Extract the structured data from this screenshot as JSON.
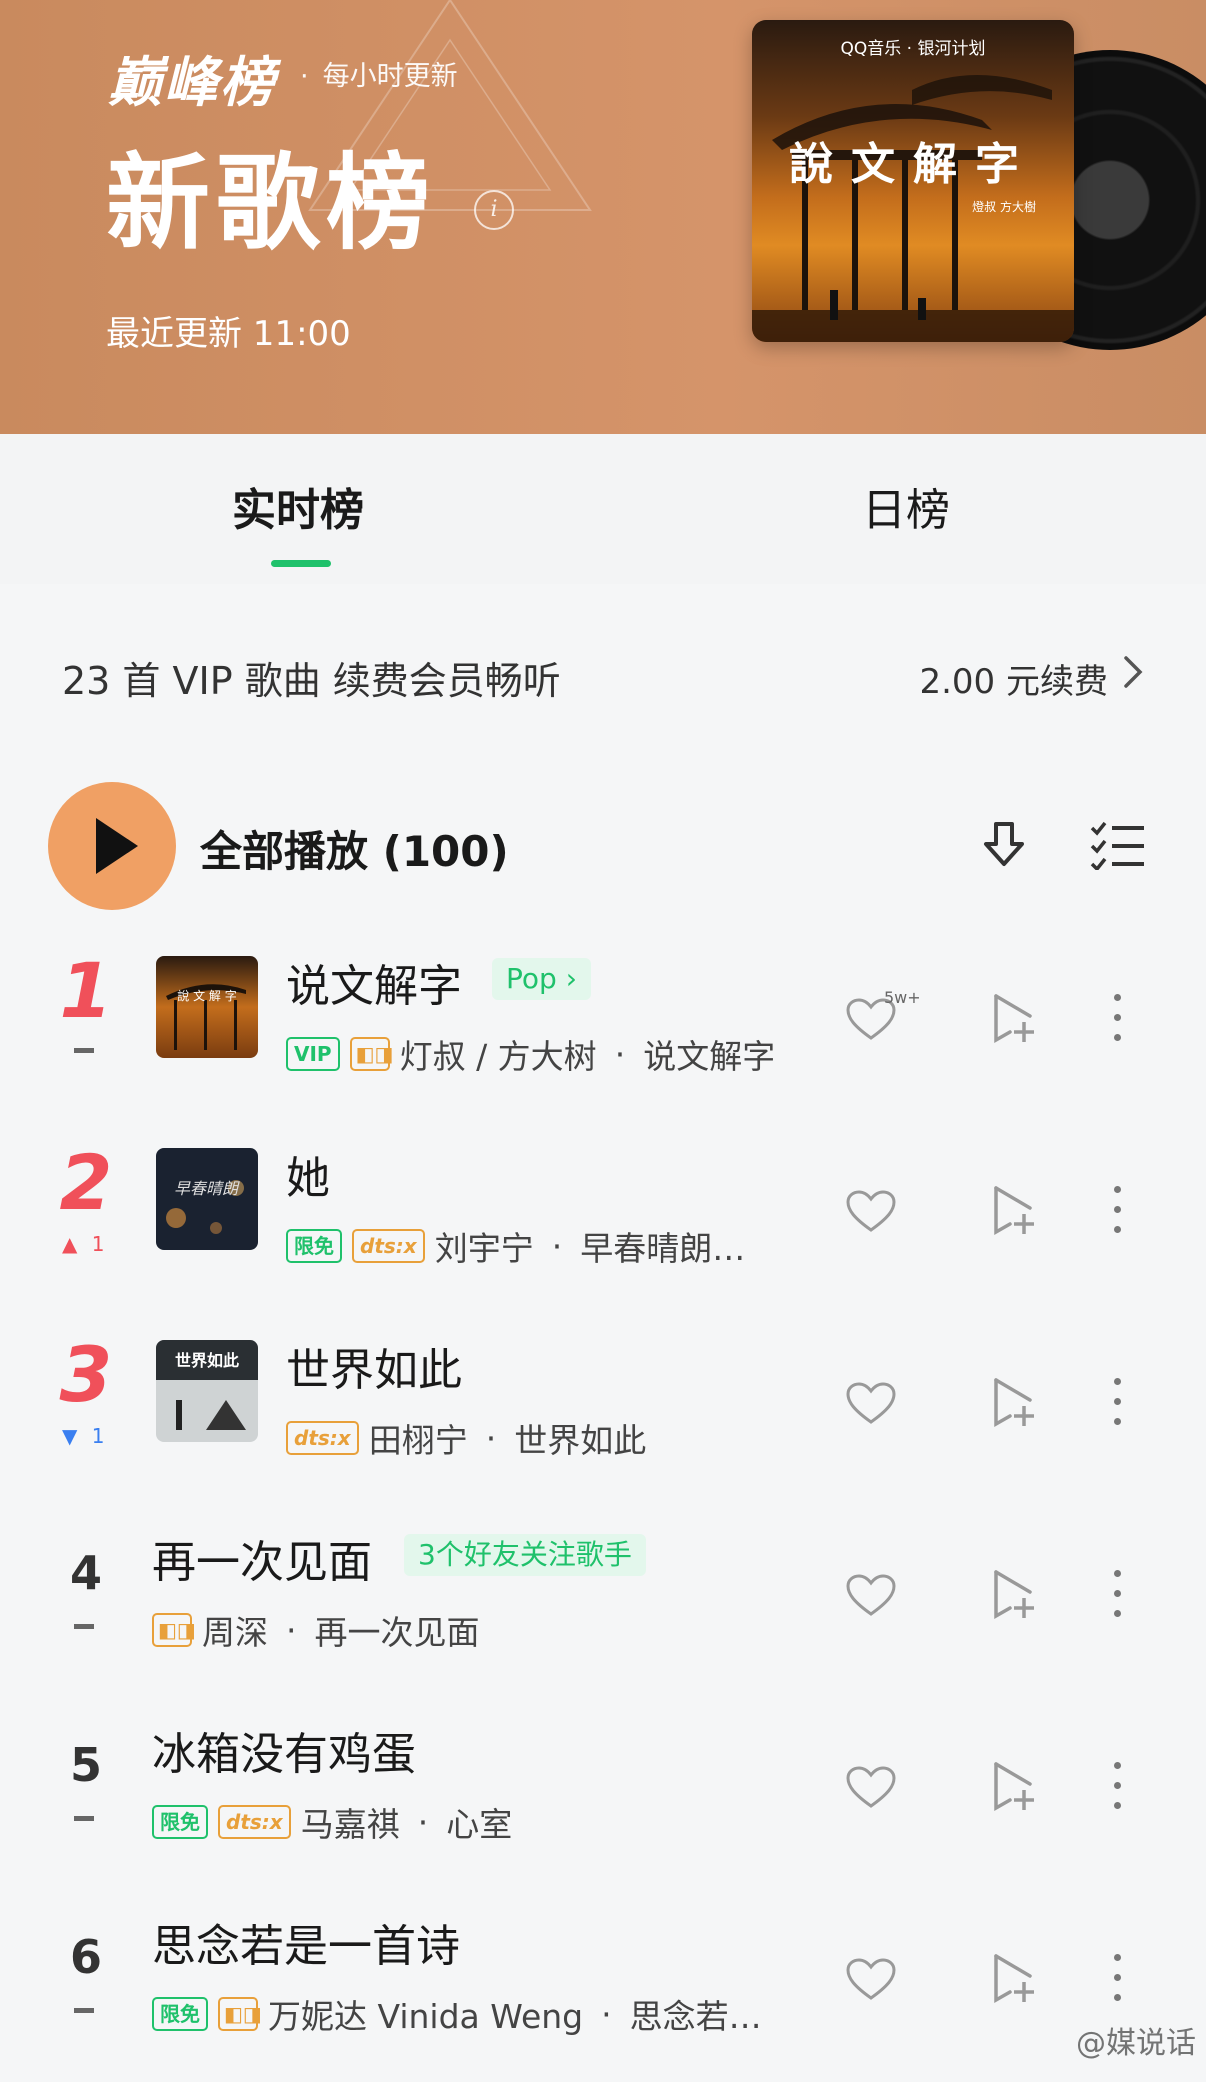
{
  "header": {
    "brand": "巅峰榜",
    "subtitle": "每小时更新",
    "title": "新歌榜",
    "update_label": "最近更新 11:00",
    "cover": {
      "top_label": "QQ音乐 · 银河计划",
      "title": "說文解字",
      "artists": "燈叔 方大樹"
    },
    "bg_color": "#cf9066"
  },
  "tabs": [
    {
      "label": "实时榜",
      "active": true
    },
    {
      "label": "日榜",
      "active": false
    }
  ],
  "vip_banner": {
    "text": "23 首 VIP 歌曲  续费会员畅听",
    "action": "2.00 元续费",
    "chevron": "chevron-right-icon"
  },
  "play_all": {
    "label": "全部播放 (100)",
    "accent": "#f0a064"
  },
  "songs": [
    {
      "rank": "1",
      "trend": "flat",
      "trend_value": "",
      "title": "说文解字",
      "tag": "Pop",
      "chips": [
        "VIP",
        "dolby"
      ],
      "artist": "灯叔 / 方大树",
      "album": "说文解字",
      "likes": "5w+"
    },
    {
      "rank": "2",
      "trend": "up",
      "trend_value": "1",
      "title": "她",
      "tag": "",
      "chips": [
        "限免",
        "dts:x"
      ],
      "artist": "刘宇宁",
      "album": "早春晴朗…",
      "likes": ""
    },
    {
      "rank": "3",
      "trend": "down",
      "trend_value": "1",
      "title": "世界如此",
      "tag": "",
      "chips": [
        "dts:x"
      ],
      "artist": "田栩宁",
      "album": "世界如此",
      "likes": ""
    },
    {
      "rank": "4",
      "trend": "flat",
      "trend_value": "",
      "title": "再一次见面",
      "tag": "3个好友关注歌手",
      "chips": [
        "dolby"
      ],
      "artist": "周深",
      "album": "再一次见面",
      "likes": ""
    },
    {
      "rank": "5",
      "trend": "flat",
      "trend_value": "",
      "title": "冰箱没有鸡蛋",
      "tag": "",
      "chips": [
        "限免",
        "dts:x"
      ],
      "artist": "马嘉祺",
      "album": "心室",
      "likes": ""
    },
    {
      "rank": "6",
      "trend": "flat",
      "trend_value": "",
      "title": "思念若是一首诗",
      "tag": "",
      "chips": [
        "限免",
        "dolby"
      ],
      "artist": "万妮达 Vinida Weng",
      "album": "思念若…",
      "likes": ""
    }
  ],
  "watermark": "@媒说话",
  "colors": {
    "green": "#1fc16b",
    "red_rank": "#f0505a",
    "blue_down": "#3a7ff0"
  }
}
